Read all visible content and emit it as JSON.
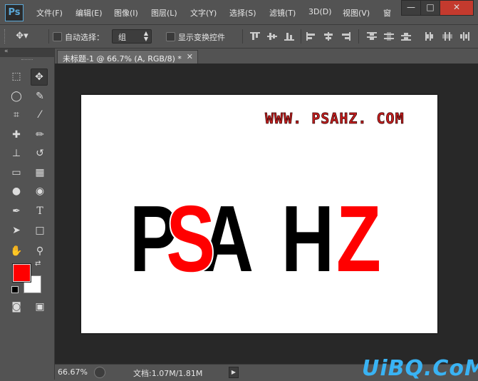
{
  "app": {
    "logo": "Ps"
  },
  "menu": [
    {
      "id": "file",
      "label": "文件(F)"
    },
    {
      "id": "edit",
      "label": "编辑(E)"
    },
    {
      "id": "image",
      "label": "图像(I)"
    },
    {
      "id": "layer",
      "label": "图层(L)"
    },
    {
      "id": "type",
      "label": "文字(Y)"
    },
    {
      "id": "select",
      "label": "选择(S)"
    },
    {
      "id": "filter",
      "label": "滤镜(T)"
    },
    {
      "id": "3d",
      "label": "3D(D)"
    },
    {
      "id": "view",
      "label": "视图(V)"
    },
    {
      "id": "window",
      "label": "窗"
    }
  ],
  "window_controls": {
    "minimize": "—",
    "maximize": "□",
    "close": "✕"
  },
  "options": {
    "auto_select_label": "自动选择：",
    "auto_select_value": "组",
    "show_transform_label": "显示变换控件"
  },
  "tools_panel": {
    "collapse_glyph": "«"
  },
  "tools": [
    {
      "name": "marquee-tool",
      "glyph": "⬚"
    },
    {
      "name": "move-tool",
      "glyph": "✥"
    },
    {
      "name": "lasso-tool",
      "glyph": "◯"
    },
    {
      "name": "quick-select-tool",
      "glyph": "✎"
    },
    {
      "name": "crop-tool",
      "glyph": "⌗"
    },
    {
      "name": "eyedropper-tool",
      "glyph": "⁄"
    },
    {
      "name": "healing-brush-tool",
      "glyph": "✚"
    },
    {
      "name": "brush-tool",
      "glyph": "✏"
    },
    {
      "name": "clone-stamp-tool",
      "glyph": "⊥"
    },
    {
      "name": "history-brush-tool",
      "glyph": "↺"
    },
    {
      "name": "eraser-tool",
      "glyph": "▭"
    },
    {
      "name": "gradient-tool",
      "glyph": "▦"
    },
    {
      "name": "blur-tool",
      "glyph": "●"
    },
    {
      "name": "dodge-tool",
      "glyph": "◉"
    },
    {
      "name": "pen-tool",
      "glyph": "✒"
    },
    {
      "name": "type-tool",
      "glyph": "T"
    },
    {
      "name": "path-select-tool",
      "glyph": "➤"
    },
    {
      "name": "rectangle-tool",
      "glyph": "□"
    },
    {
      "name": "hand-tool",
      "glyph": "✋"
    },
    {
      "name": "zoom-tool",
      "glyph": "⚲"
    },
    {
      "name": "quick-mask-button",
      "glyph": "◙"
    },
    {
      "name": "screen-mode-button",
      "glyph": "▣"
    }
  ],
  "colors": {
    "foreground": "#ff0000",
    "background": "#ffffff",
    "canvas_text_dark": "#000000",
    "canvas_text_red": "#ff0000",
    "small_text_fill": "#c81e1e",
    "small_text_stroke": "#3a0a0a"
  },
  "document": {
    "tab_title": "未标题-1 @ 66.7% (A, RGB/8) *",
    "tab_close": "✕"
  },
  "canvas_content": {
    "small_text": "WWW. PSAHZ. COM",
    "big_letters": [
      {
        "char": "P",
        "color": "#000000"
      },
      {
        "char": "S",
        "color": "#ff0000"
      },
      {
        "char": "A",
        "color": "#000000"
      },
      {
        "char": "H",
        "color": "#000000"
      },
      {
        "char": "Z",
        "color": "#ff0000"
      }
    ]
  },
  "status": {
    "zoom": "66.67%",
    "doc_info": "文档:1.07M/1.81M",
    "arrow": "▶"
  },
  "watermark": "UiBQ.CoM"
}
